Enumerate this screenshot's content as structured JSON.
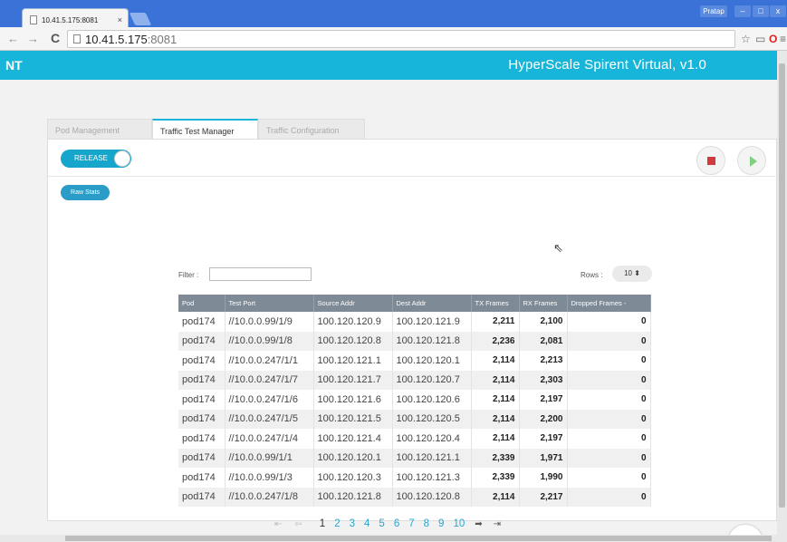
{
  "browser": {
    "tab_title": "10.41.5.175:8081",
    "tab_close": "×",
    "url_host": "10.41.5.175",
    "url_port": ":8081",
    "user": "Pratap",
    "win_min": "–",
    "win_max": "□",
    "win_close": "x",
    "back": "←",
    "forward": "→",
    "reload": "C",
    "star": "☆",
    "cast": "▭",
    "opera": "O",
    "menu": "≡"
  },
  "app": {
    "logo": "NT",
    "title": "HyperScale Spirent Virtual, v1.0",
    "accent": "#16b5d9"
  },
  "tabs": [
    {
      "label": "Pod Management",
      "active": false
    },
    {
      "label": "Traffic Test Manager",
      "active": true
    },
    {
      "label": "Traffic Configuration",
      "active": false
    }
  ],
  "controls": {
    "release_label": "RELEASE",
    "raw_stats_label": "Raw Stats",
    "filter_label": "Filter :",
    "filter_value": "",
    "rows_label": "Rows :",
    "rows_value": "10 ⬍"
  },
  "table": {
    "headers": [
      "Pod",
      "Test Port",
      "Source Addr",
      "Dest Addr",
      "TX Frames",
      "RX Frames",
      "Dropped Frames -"
    ],
    "rows": [
      [
        "pod174",
        "//10.0.0.99/1/9",
        "100.120.120.9",
        "100.120.121.9",
        "2,211",
        "2,100",
        "0"
      ],
      [
        "pod174",
        "//10.0.0.99/1/8",
        "100.120.120.8",
        "100.120.121.8",
        "2,236",
        "2,081",
        "0"
      ],
      [
        "pod174",
        "//10.0.0.247/1/1",
        "100.120.121.1",
        "100.120.120.1",
        "2,114",
        "2,213",
        "0"
      ],
      [
        "pod174",
        "//10.0.0.247/1/7",
        "100.120.121.7",
        "100.120.120.7",
        "2,114",
        "2,303",
        "0"
      ],
      [
        "pod174",
        "//10.0.0.247/1/6",
        "100.120.121.6",
        "100.120.120.6",
        "2,114",
        "2,197",
        "0"
      ],
      [
        "pod174",
        "//10.0.0.247/1/5",
        "100.120.121.5",
        "100.120.120.5",
        "2,114",
        "2,200",
        "0"
      ],
      [
        "pod174",
        "//10.0.0.247/1/4",
        "100.120.121.4",
        "100.120.120.4",
        "2,114",
        "2,197",
        "0"
      ],
      [
        "pod174",
        "//10.0.0.99/1/1",
        "100.120.120.1",
        "100.120.121.1",
        "2,339",
        "1,971",
        "0"
      ],
      [
        "pod174",
        "//10.0.0.99/1/3",
        "100.120.120.3",
        "100.120.121.3",
        "2,339",
        "1,990",
        "0"
      ],
      [
        "pod174",
        "//10.0.0.247/1/8",
        "100.120.121.8",
        "100.120.120.8",
        "2,114",
        "2,217",
        "0"
      ]
    ]
  },
  "pagination": {
    "first": "⇤",
    "prev": "⇦",
    "pages": [
      "1",
      "2",
      "3",
      "4",
      "5",
      "6",
      "7",
      "8",
      "9",
      "10"
    ],
    "current": "1",
    "next": "➡",
    "last": "⇥"
  }
}
